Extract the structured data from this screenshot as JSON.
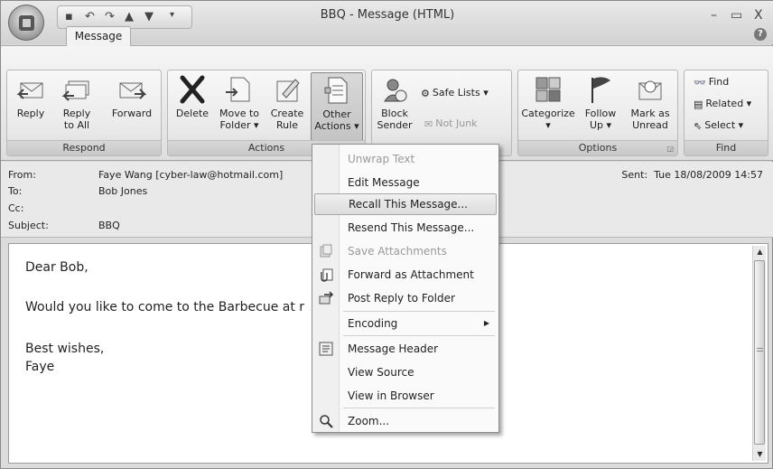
{
  "window": {
    "title": "BBQ - Message (HTML)",
    "controls": {
      "minimize": "–",
      "maximize": "▭",
      "close": "X"
    }
  },
  "ribbon": {
    "tab": "Message",
    "groups": {
      "respond": {
        "label": "Respond",
        "reply": "Reply",
        "reply_all_1": "Reply",
        "reply_all_2": "to All",
        "forward": "Forward"
      },
      "actions": {
        "label": "Actions",
        "delete": "Delete",
        "move_1": "Move to",
        "move_2": "Folder ▾",
        "create_1": "Create",
        "create_2": "Rule",
        "other_1": "Other",
        "other_2": "Actions ▾"
      },
      "junk": {
        "block_1": "Block",
        "block_2": "Sender",
        "safe_lists": "Safe Lists ▾",
        "not_junk": "Not Junk"
      },
      "options": {
        "label": "Options",
        "categorize": "Categorize",
        "categorize_arrow": "▾",
        "follow_1": "Follow",
        "follow_2": "Up ▾",
        "mark_1": "Mark as",
        "mark_2": "Unread"
      },
      "find": {
        "label": "Find",
        "find": "Find",
        "related": "Related ▾",
        "select": "Select ▾"
      }
    }
  },
  "header": {
    "from_label": "From:",
    "from": "Faye Wang [cyber-law@hotmail.com]",
    "to_label": "To:",
    "to": "Bob Jones",
    "cc_label": "Cc:",
    "subject_label": "Subject:",
    "subject": "BBQ",
    "sent_label": "Sent:",
    "sent": "Tue 18/08/2009 14:57"
  },
  "body": {
    "greeting": "Dear Bob,",
    "line1": "Would you like to come to the Barbecue at r",
    "closing": "Best wishes,",
    "signature": "Faye"
  },
  "menu": {
    "unwrap": "Unwrap Text",
    "edit": "Edit Message",
    "recall": "Recall This Message...",
    "resend": "Resend This Message...",
    "save_att": "Save Attachments",
    "forward_att": "Forward as Attachment",
    "post_reply": "Post Reply to Folder",
    "encoding": "Encoding",
    "header": "Message Header",
    "view_source": "View Source",
    "view_browser": "View in Browser",
    "zoom": "Zoom..."
  }
}
